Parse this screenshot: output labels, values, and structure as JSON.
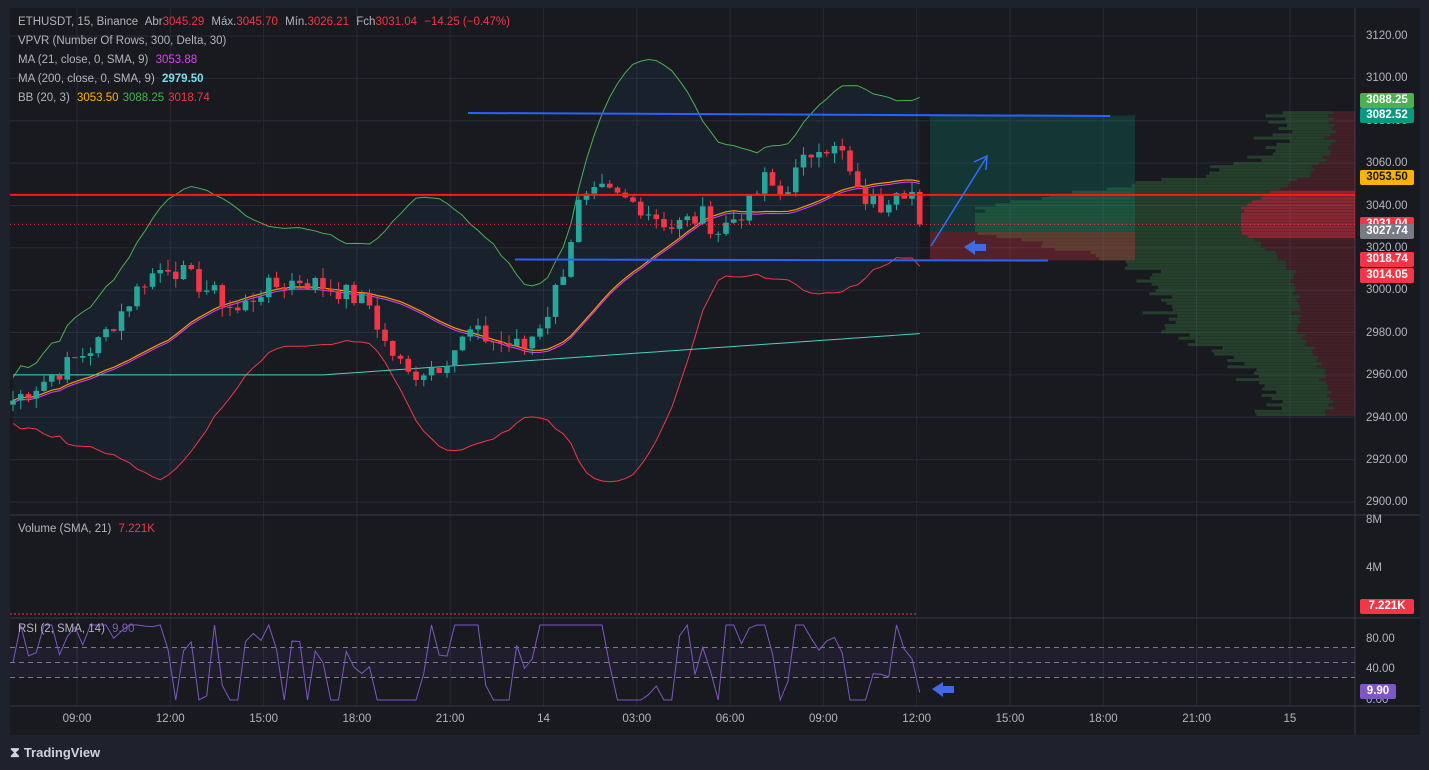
{
  "header": {
    "symbol": "ETHUSDT, 15, Binance",
    "open_label": "Abr",
    "open": "3045.29",
    "high_label": "Máx.",
    "high": "3045.70",
    "low_label": "Mín.",
    "low": "3026.21",
    "close_label": "Fch",
    "close": "3031.04",
    "change": "−14.25 (−0.47%)"
  },
  "indicators": {
    "vpvr": "VPVR (Number Of Rows, 300, Delta, 30)",
    "ma21_label": "MA (21, close, 0, SMA, 9)",
    "ma21_value": "3053.88",
    "ma200_label": "MA (200, close, 0, SMA, 9)",
    "ma200_value": "2979.50",
    "bb_label": "BB (20, 3)",
    "bb_basis": "3053.50",
    "bb_upper": "3088.25",
    "bb_lower": "3018.74",
    "volume_label": "Volume (SMA, 21)",
    "volume_value": "7.221K",
    "rsi_label": "RSI (2, SMA, 14)",
    "rsi_value": "9.90"
  },
  "price_axis": {
    "ticks": [
      "3120.00",
      "3100.00",
      "3080.00",
      "3060.00",
      "3040.00",
      "3020.00",
      "3000.00",
      "2980.00",
      "2960.00",
      "2940.00",
      "2920.00",
      "2900.00"
    ],
    "tags": [
      {
        "v": "3088.25",
        "c": "#4caf50"
      },
      {
        "v": "3082.52",
        "c": "#089981"
      },
      {
        "v": "3053.50",
        "c": "#ffb300"
      },
      {
        "v": "3031.04",
        "c": "#f23645"
      },
      {
        "v": "3027.74",
        "c": "#787b86"
      },
      {
        "v": "3018.74",
        "c": "#f23645"
      },
      {
        "v": "3014.05",
        "c": "#f23645"
      }
    ]
  },
  "volume_axis": {
    "ticks": [
      "8M",
      "4M"
    ],
    "tag": "7.221K"
  },
  "rsi_axis": {
    "ticks": [
      "80.00",
      "40.00",
      "0.00"
    ],
    "tag": "9.90"
  },
  "time_axis": [
    "09:00",
    "12:00",
    "15:00",
    "18:00",
    "21:00",
    "14",
    "03:00",
    "06:00",
    "09:00",
    "12:00",
    "15:00",
    "18:00",
    "21:00",
    "15"
  ],
  "brand": "TradingView",
  "colors": {
    "up": "#26a69a",
    "down": "#f23645",
    "bb_upper": "#4caf50",
    "bb_lower": "#f23645",
    "ma21": "#e040fb",
    "ma200": "#4dd0c0",
    "basis": "#ff9800",
    "drawing": "#2962ff"
  },
  "chart_data": {
    "type": "candlestick",
    "price_range": [
      2900,
      3120
    ],
    "close_keypoints": [
      [
        0,
        2948
      ],
      [
        6,
        2962
      ],
      [
        11,
        2975
      ],
      [
        14,
        2990
      ],
      [
        17,
        3005
      ],
      [
        20,
        3012
      ],
      [
        24,
        3003
      ],
      [
        29,
        2990
      ],
      [
        32,
        3000
      ],
      [
        37,
        3005
      ],
      [
        42,
        3000
      ],
      [
        46,
        2993
      ],
      [
        48,
        2975
      ],
      [
        51,
        2960
      ],
      [
        55,
        2965
      ],
      [
        59,
        2980
      ],
      [
        63,
        2975
      ],
      [
        66,
        2973
      ],
      [
        69,
        2990
      ],
      [
        71,
        3010
      ],
      [
        73,
        3040
      ],
      [
        76,
        3046
      ],
      [
        81,
        3040
      ],
      [
        85,
        3030
      ],
      [
        89,
        3035
      ],
      [
        91,
        3028
      ],
      [
        95,
        3040
      ],
      [
        97,
        3052
      ],
      [
        99,
        3045
      ],
      [
        102,
        3060
      ],
      [
        104,
        3070
      ],
      [
        107,
        3064
      ],
      [
        109,
        3045
      ],
      [
        112,
        3040
      ],
      [
        114,
        3050
      ],
      [
        116,
        3046
      ],
      [
        117,
        3031
      ]
    ],
    "ma200_range": [
      2960,
      2979.5
    ],
    "position": {
      "entry": 3027.74,
      "target": 3082.52,
      "stop": 3014.05
    },
    "levels": {
      "resistance": 3083,
      "support": 3014,
      "red_line": 3045,
      "last": 3031.04
    }
  }
}
